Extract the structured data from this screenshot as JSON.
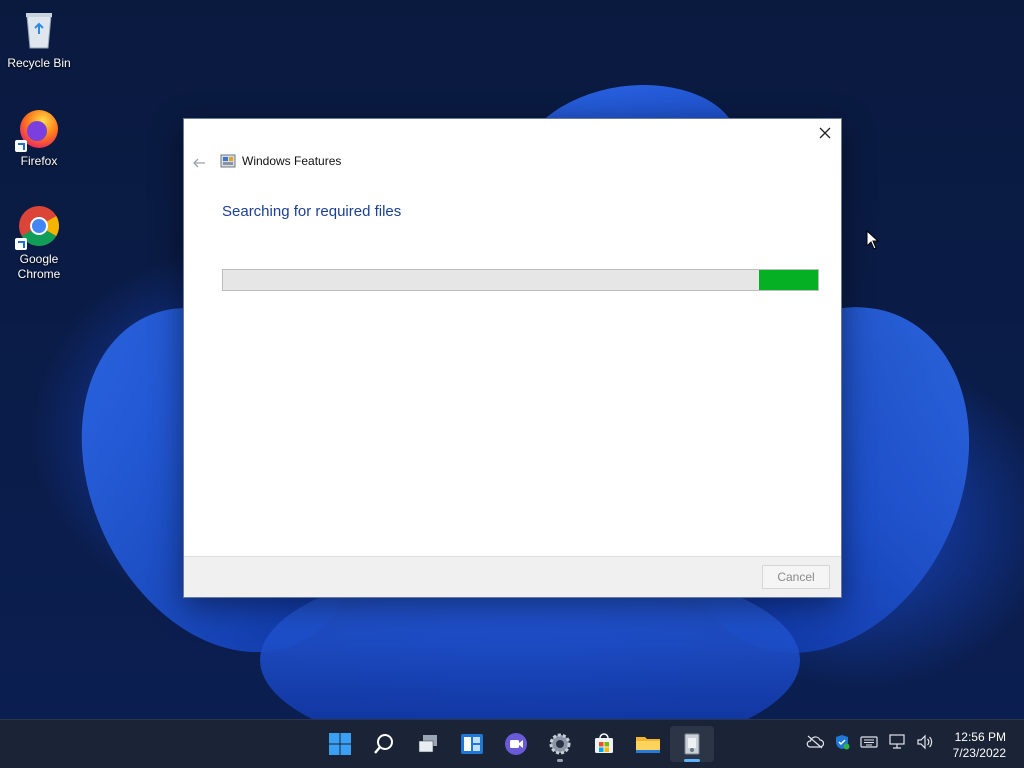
{
  "desktop": {
    "icons": [
      {
        "label": "Recycle Bin"
      },
      {
        "label": "Firefox"
      },
      {
        "label": "Google Chrome"
      }
    ]
  },
  "dialog": {
    "title": "Windows Features",
    "heading": "Searching for required files",
    "progress_percent": 10,
    "cancel_label": "Cancel",
    "close_icon": "close-icon",
    "back_icon": "back-arrow-icon"
  },
  "taskbar": {
    "apps": [
      "start",
      "search",
      "task-view",
      "widgets",
      "chat",
      "settings",
      "store",
      "file-explorer",
      "windows-features"
    ],
    "clock": {
      "time": "12:56 PM",
      "date": "7/23/2022"
    }
  },
  "colors": {
    "progress": "#06b025",
    "heading": "#1c3f94",
    "taskbar": "#1b2436"
  }
}
